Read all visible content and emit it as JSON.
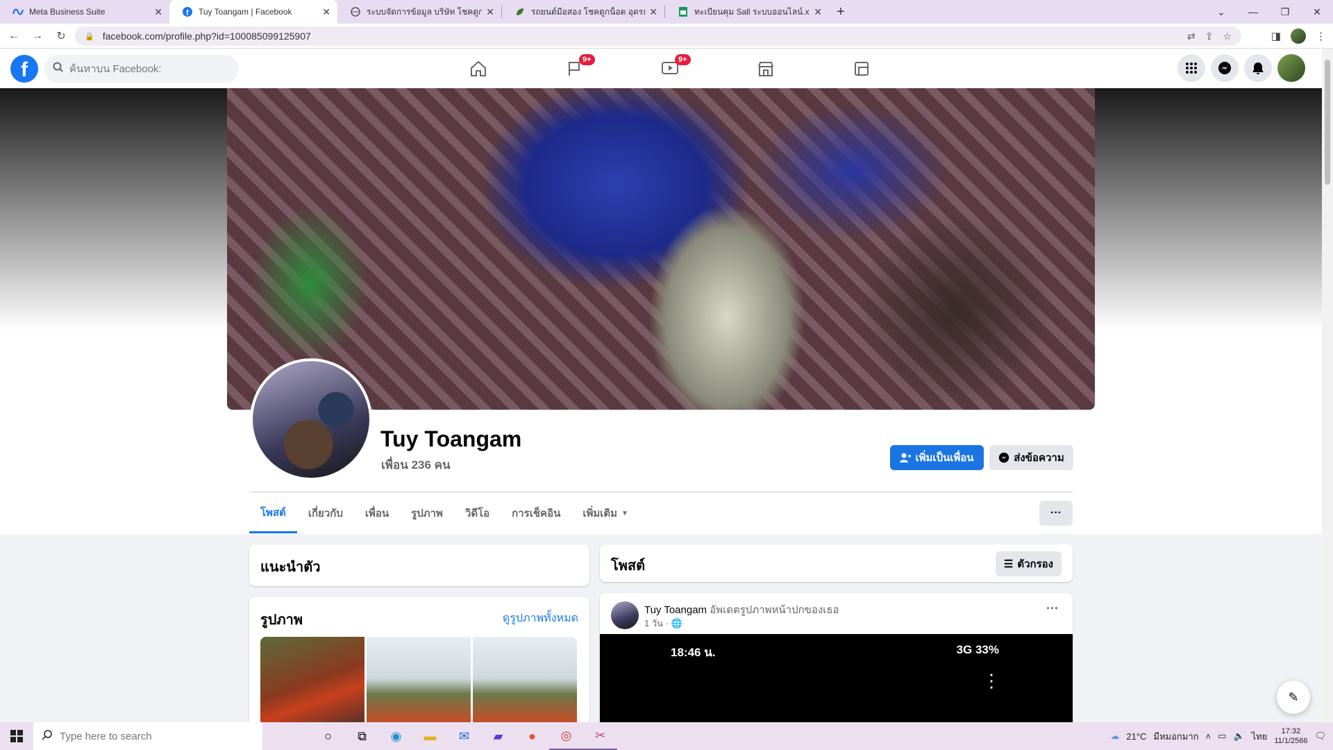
{
  "browser": {
    "tabs": [
      {
        "title": "Meta Business Suite",
        "favicon": "meta-icon"
      },
      {
        "title": "Tuy Toangam | Facebook",
        "favicon": "facebook-icon"
      },
      {
        "title": "ระบบจัดการข้อมูล บริษัท โชคดูกน็อต ยุ",
        "favicon": "globe-icon"
      },
      {
        "title": "รถยนต์มือสอง โชคดูกน็อต อุดรธานี",
        "favicon": "leaf-icon"
      },
      {
        "title": "ทะเบียนคุม Sall ระบบออนไลน์.xlsx - G",
        "favicon": "sheets-icon"
      }
    ],
    "new_tab": "+",
    "url": "facebook.com/profile.php?id=100085099125907"
  },
  "fb_header": {
    "logo": "f",
    "search_placeholder": "ค้นหาบน Facebook:",
    "nav_badges": {
      "pages": "9+",
      "watch": "9+"
    }
  },
  "profile": {
    "name": "Tuy Toangam",
    "friends": "เพื่อน 236 คน",
    "add_friend_label": "เพิ่มเป็นเพื่อน",
    "message_label": "ส่งข้อความ",
    "tabs": [
      "โพสต์",
      "เกี่ยวกับ",
      "เพื่อน",
      "รูปภาพ",
      "วิดีโอ",
      "การเช็คอิน",
      "เพิ่มเติม"
    ],
    "more_dots": "···"
  },
  "intro": {
    "title": "แนะนำตัว"
  },
  "photos": {
    "title": "รูปภาพ",
    "see_all": "ดูรูปภาพทั้งหมด"
  },
  "posts": {
    "title": "โพสต์",
    "filter_label": "ตัวกรอง"
  },
  "post": {
    "author": "Tuy Toangam",
    "action": "อัพเดตรูปภาพหน้าปกของเธอ",
    "meta": "1 วัน · ",
    "media_time": "18:46 น.",
    "media_status": "3G 33%"
  },
  "taskbar": {
    "search_placeholder": "Type here to search",
    "weather": "21°C",
    "weather_desc": "มีหมอกมาก",
    "lang": "ไทย",
    "time": "17:32",
    "date": "11/1/2566"
  }
}
